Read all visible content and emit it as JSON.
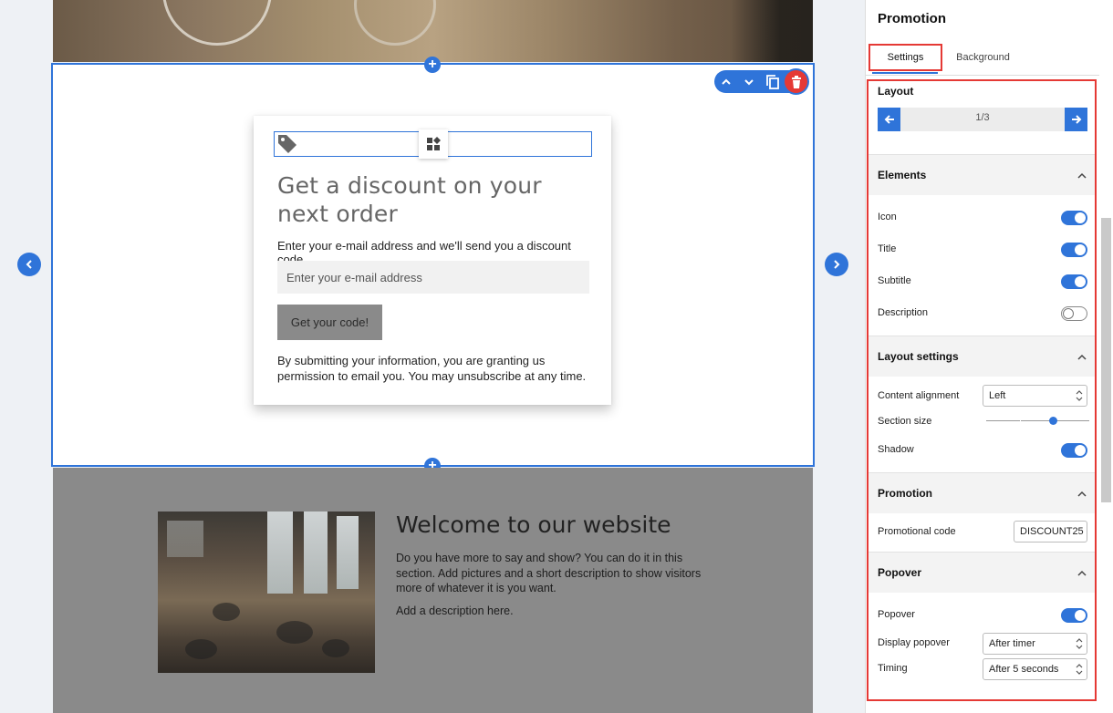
{
  "canvas": {
    "promo": {
      "title": "Get a discount on your next order",
      "subtitle": "Enter your e-mail address and we'll send you a discount code",
      "email_placeholder": "Enter your e-mail address",
      "button_label": "Get your code!",
      "description": "By submitting your information, you are granting us permission to email you. You may unsubscribe at any time."
    },
    "welcome": {
      "title": "Welcome to our website",
      "text": "Do you have more to say and show? You can do it in this section. Add pictures and a short description to show visitors more of whatever it is you want.",
      "description": "Add a description here."
    }
  },
  "panel": {
    "title": "Promotion",
    "tabs": {
      "settings": "Settings",
      "background": "Background"
    },
    "layout": {
      "label": "Layout",
      "pager": "1/3"
    },
    "elements": {
      "label": "Elements",
      "items": [
        {
          "label": "Icon",
          "on": true
        },
        {
          "label": "Title",
          "on": true
        },
        {
          "label": "Subtitle",
          "on": true
        },
        {
          "label": "Description",
          "on": false
        }
      ]
    },
    "layout_settings": {
      "label": "Layout settings",
      "content_alignment_label": "Content alignment",
      "content_alignment_value": "Left",
      "section_size_label": "Section size",
      "section_size_level": 0.65,
      "shadow_label": "Shadow",
      "shadow_on": true
    },
    "promotion": {
      "label": "Promotion",
      "code_label": "Promotional code",
      "code_value": "DISCOUNT25"
    },
    "popover": {
      "label": "Popover",
      "popover_label": "Popover",
      "popover_on": true,
      "display_label": "Display popover",
      "display_value": "After timer",
      "timing_label": "Timing",
      "timing_value": "After 5 seconds"
    }
  },
  "colors": {
    "accent": "#2f74d9",
    "highlight": "#e53935",
    "section_gray": "#8a8a8a"
  }
}
